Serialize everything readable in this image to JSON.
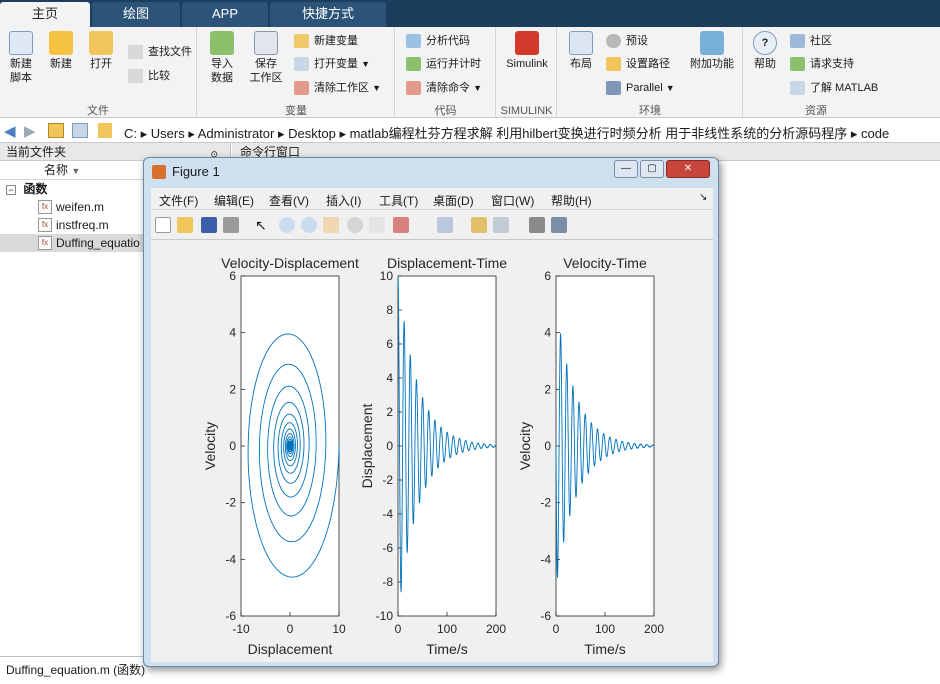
{
  "tabs": [
    "主页",
    "绘图",
    "APP",
    "快捷方式"
  ],
  "ribbon": {
    "file": {
      "label": "文件",
      "new_script": "新建\n脚本",
      "new": "新建",
      "open": "打开",
      "find_files": "查找文件",
      "compare": "比较"
    },
    "variable": {
      "label": "变量",
      "import": "导入\n数据",
      "save_ws": "保存\n工作区",
      "new_var": "新建变量",
      "open_var": "打开变量",
      "clear_ws": "清除工作区"
    },
    "code": {
      "label": "代码",
      "analyze": "分析代码",
      "run_time": "运行并计时",
      "clear_cmd": "清除命令"
    },
    "simulink": {
      "label": "SIMULINK",
      "btn": "Simulink"
    },
    "env": {
      "label": "环境",
      "layout": "布局",
      "prefs": "预设",
      "set_path": "设置路径",
      "parallel": "Parallel",
      "addons": "附加功能"
    },
    "resources": {
      "label": "资源",
      "help": "帮助",
      "community": "社区",
      "support": "请求支持",
      "learn": "了解 MATLAB"
    }
  },
  "address": {
    "segments": [
      "C:",
      "Users",
      "Administrator",
      "Desktop",
      "matlab编程杜芬方程求解 利用hilbert变换进行时频分析 用于非线性系统的分析源码程序",
      "code"
    ]
  },
  "current_folder": {
    "title": "当前文件夹",
    "column_name": "名称",
    "group": "函数",
    "files": [
      "weifen.m",
      "instfreq.m",
      "Duffing_equatio"
    ],
    "detail": "Duffing_equation.m  (函数)"
  },
  "command_window": {
    "title": "命令行窗口"
  },
  "figure": {
    "title": "Figure 1",
    "menu": [
      "文件(F)",
      "编辑(E)",
      "查看(V)",
      "插入(I)",
      "工具(T)",
      "桌面(D)",
      "窗口(W)",
      "帮助(H)"
    ]
  },
  "colors": {
    "line": "#0072bd",
    "tabbar": "#1d3d5c",
    "ribbon": "#f3f3f3"
  },
  "chart_data": [
    {
      "type": "line",
      "title": "Velocity-Displacement",
      "xlabel": "Displacement",
      "ylabel": "Velocity",
      "xlim": [
        -10,
        10
      ],
      "ylim": [
        -6,
        6
      ],
      "xticks": [
        -10,
        0,
        10
      ],
      "yticks": [
        -6,
        -4,
        -2,
        0,
        2,
        4,
        6
      ],
      "description": "decaying spiral",
      "series": [
        {
          "x0": 10,
          "v0": 0,
          "decay": 0.025,
          "omega": 0.5
        }
      ]
    },
    {
      "type": "line",
      "title": "Displacement-Time",
      "xlabel": "Time/s",
      "ylabel": "Displacement",
      "xlim": [
        0,
        200
      ],
      "ylim": [
        -10,
        10
      ],
      "xticks": [
        0,
        100,
        200
      ],
      "yticks": [
        -10,
        -8,
        -6,
        -4,
        -2,
        0,
        2,
        4,
        6,
        8,
        10
      ],
      "series": [
        {
          "amplitude": 10,
          "decay": 0.025,
          "omega": 0.5
        }
      ]
    },
    {
      "type": "line",
      "title": "Velocity-Time",
      "xlabel": "Time/s",
      "ylabel": "Velocity",
      "xlim": [
        0,
        200
      ],
      "ylim": [
        -6,
        6
      ],
      "xticks": [
        0,
        100,
        200
      ],
      "yticks": [
        -6,
        -4,
        -2,
        0,
        2,
        4,
        6
      ],
      "series": [
        {
          "amplitude": 5,
          "decay": 0.025,
          "omega": 0.5
        }
      ]
    }
  ]
}
